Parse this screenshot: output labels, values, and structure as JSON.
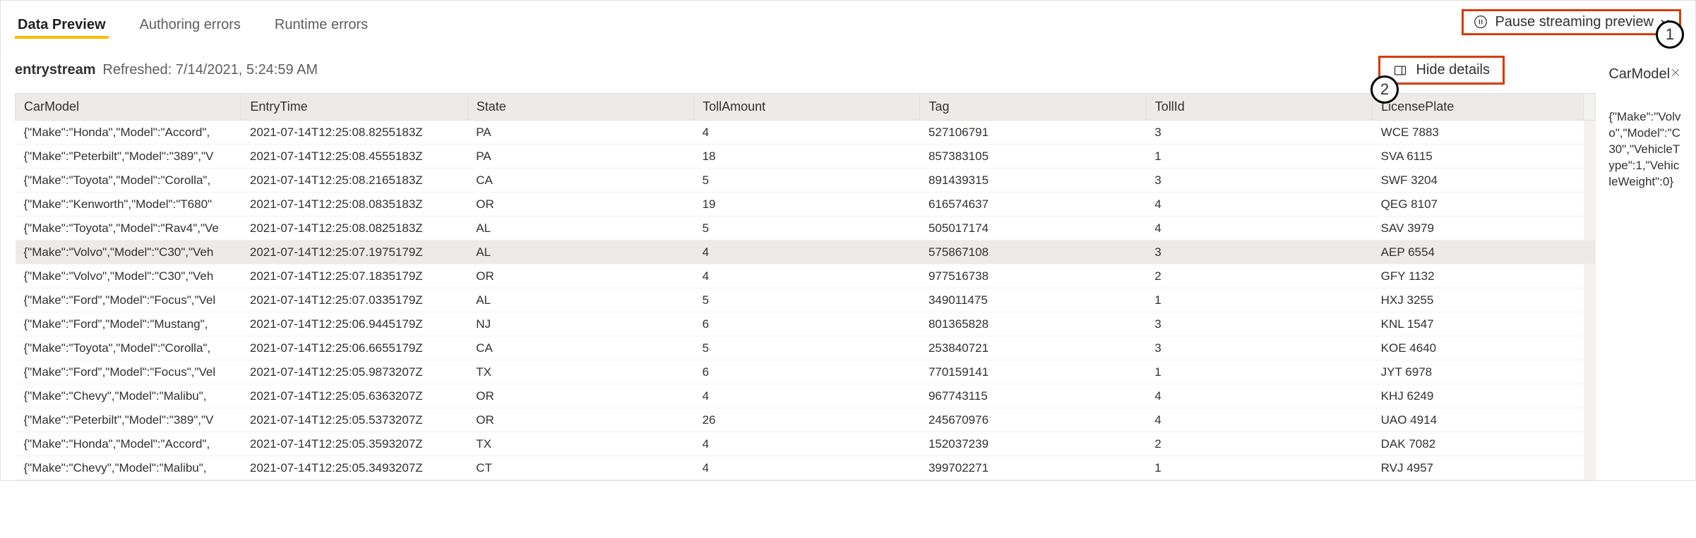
{
  "tabs": {
    "data_preview": "Data Preview",
    "authoring_errors": "Authoring errors",
    "runtime_errors": "Runtime errors"
  },
  "pause_button_label": "Pause streaming preview",
  "stream": {
    "name": "entrystream",
    "refreshed_label": "Refreshed: 7/14/2021, 5:24:59 AM"
  },
  "hide_details_label": "Hide details",
  "details": {
    "header": "CarModel",
    "body": "{\"Make\":\"Volvo\",\"Model\":\"C30\",\"VehicleType\":1,\"VehicleWeight\":0}"
  },
  "annotations": {
    "one": "1",
    "two": "2"
  },
  "table": {
    "headers": {
      "car_model": "CarModel",
      "entry_time": "EntryTime",
      "state": "State",
      "toll_amount": "TollAmount",
      "tag": "Tag",
      "toll_id": "TollId",
      "license_plate": "LicensePlate"
    },
    "rows": [
      {
        "car_model": "{\"Make\":\"Honda\",\"Model\":\"Accord\",",
        "entry_time": "2021-07-14T12:25:08.8255183Z",
        "state": "PA",
        "toll_amount": "4",
        "tag": "527106791",
        "toll_id": "3",
        "plate": "WCE 7883",
        "selected": false
      },
      {
        "car_model": "{\"Make\":\"Peterbilt\",\"Model\":\"389\",\"V",
        "entry_time": "2021-07-14T12:25:08.4555183Z",
        "state": "PA",
        "toll_amount": "18",
        "tag": "857383105",
        "toll_id": "1",
        "plate": "SVA 6115",
        "selected": false
      },
      {
        "car_model": "{\"Make\":\"Toyota\",\"Model\":\"Corolla\",",
        "entry_time": "2021-07-14T12:25:08.2165183Z",
        "state": "CA",
        "toll_amount": "5",
        "tag": "891439315",
        "toll_id": "3",
        "plate": "SWF 3204",
        "selected": false
      },
      {
        "car_model": "{\"Make\":\"Kenworth\",\"Model\":\"T680\"",
        "entry_time": "2021-07-14T12:25:08.0835183Z",
        "state": "OR",
        "toll_amount": "19",
        "tag": "616574637",
        "toll_id": "4",
        "plate": "QEG 8107",
        "selected": false
      },
      {
        "car_model": "{\"Make\":\"Toyota\",\"Model\":\"Rav4\",\"Ve",
        "entry_time": "2021-07-14T12:25:08.0825183Z",
        "state": "AL",
        "toll_amount": "5",
        "tag": "505017174",
        "toll_id": "4",
        "plate": "SAV 3979",
        "selected": false
      },
      {
        "car_model": "{\"Make\":\"Volvo\",\"Model\":\"C30\",\"Veh",
        "entry_time": "2021-07-14T12:25:07.1975179Z",
        "state": "AL",
        "toll_amount": "4",
        "tag": "575867108",
        "toll_id": "3",
        "plate": "AEP 6554",
        "selected": true
      },
      {
        "car_model": "{\"Make\":\"Volvo\",\"Model\":\"C30\",\"Veh",
        "entry_time": "2021-07-14T12:25:07.1835179Z",
        "state": "OR",
        "toll_amount": "4",
        "tag": "977516738",
        "toll_id": "2",
        "plate": "GFY 1132",
        "selected": false
      },
      {
        "car_model": "{\"Make\":\"Ford\",\"Model\":\"Focus\",\"Vel",
        "entry_time": "2021-07-14T12:25:07.0335179Z",
        "state": "AL",
        "toll_amount": "5",
        "tag": "349011475",
        "toll_id": "1",
        "plate": "HXJ 3255",
        "selected": false
      },
      {
        "car_model": "{\"Make\":\"Ford\",\"Model\":\"Mustang\",",
        "entry_time": "2021-07-14T12:25:06.9445179Z",
        "state": "NJ",
        "toll_amount": "6",
        "tag": "801365828",
        "toll_id": "3",
        "plate": "KNL 1547",
        "selected": false
      },
      {
        "car_model": "{\"Make\":\"Toyota\",\"Model\":\"Corolla\",",
        "entry_time": "2021-07-14T12:25:06.6655179Z",
        "state": "CA",
        "toll_amount": "5",
        "tag": "253840721",
        "toll_id": "3",
        "plate": "KOE 4640",
        "selected": false
      },
      {
        "car_model": "{\"Make\":\"Ford\",\"Model\":\"Focus\",\"Vel",
        "entry_time": "2021-07-14T12:25:05.9873207Z",
        "state": "TX",
        "toll_amount": "6",
        "tag": "770159141",
        "toll_id": "1",
        "plate": "JYT 6978",
        "selected": false
      },
      {
        "car_model": "{\"Make\":\"Chevy\",\"Model\":\"Malibu\",",
        "entry_time": "2021-07-14T12:25:05.6363207Z",
        "state": "OR",
        "toll_amount": "4",
        "tag": "967743115",
        "toll_id": "4",
        "plate": "KHJ 6249",
        "selected": false
      },
      {
        "car_model": "{\"Make\":\"Peterbilt\",\"Model\":\"389\",\"V",
        "entry_time": "2021-07-14T12:25:05.5373207Z",
        "state": "OR",
        "toll_amount": "26",
        "tag": "245670976",
        "toll_id": "4",
        "plate": "UAO 4914",
        "selected": false
      },
      {
        "car_model": "{\"Make\":\"Honda\",\"Model\":\"Accord\",",
        "entry_time": "2021-07-14T12:25:05.3593207Z",
        "state": "TX",
        "toll_amount": "4",
        "tag": "152037239",
        "toll_id": "2",
        "plate": "DAK 7082",
        "selected": false
      },
      {
        "car_model": "{\"Make\":\"Chevy\",\"Model\":\"Malibu\",",
        "entry_time": "2021-07-14T12:25:05.3493207Z",
        "state": "CT",
        "toll_amount": "4",
        "tag": "399702271",
        "toll_id": "1",
        "plate": "RVJ 4957",
        "selected": false
      }
    ]
  }
}
